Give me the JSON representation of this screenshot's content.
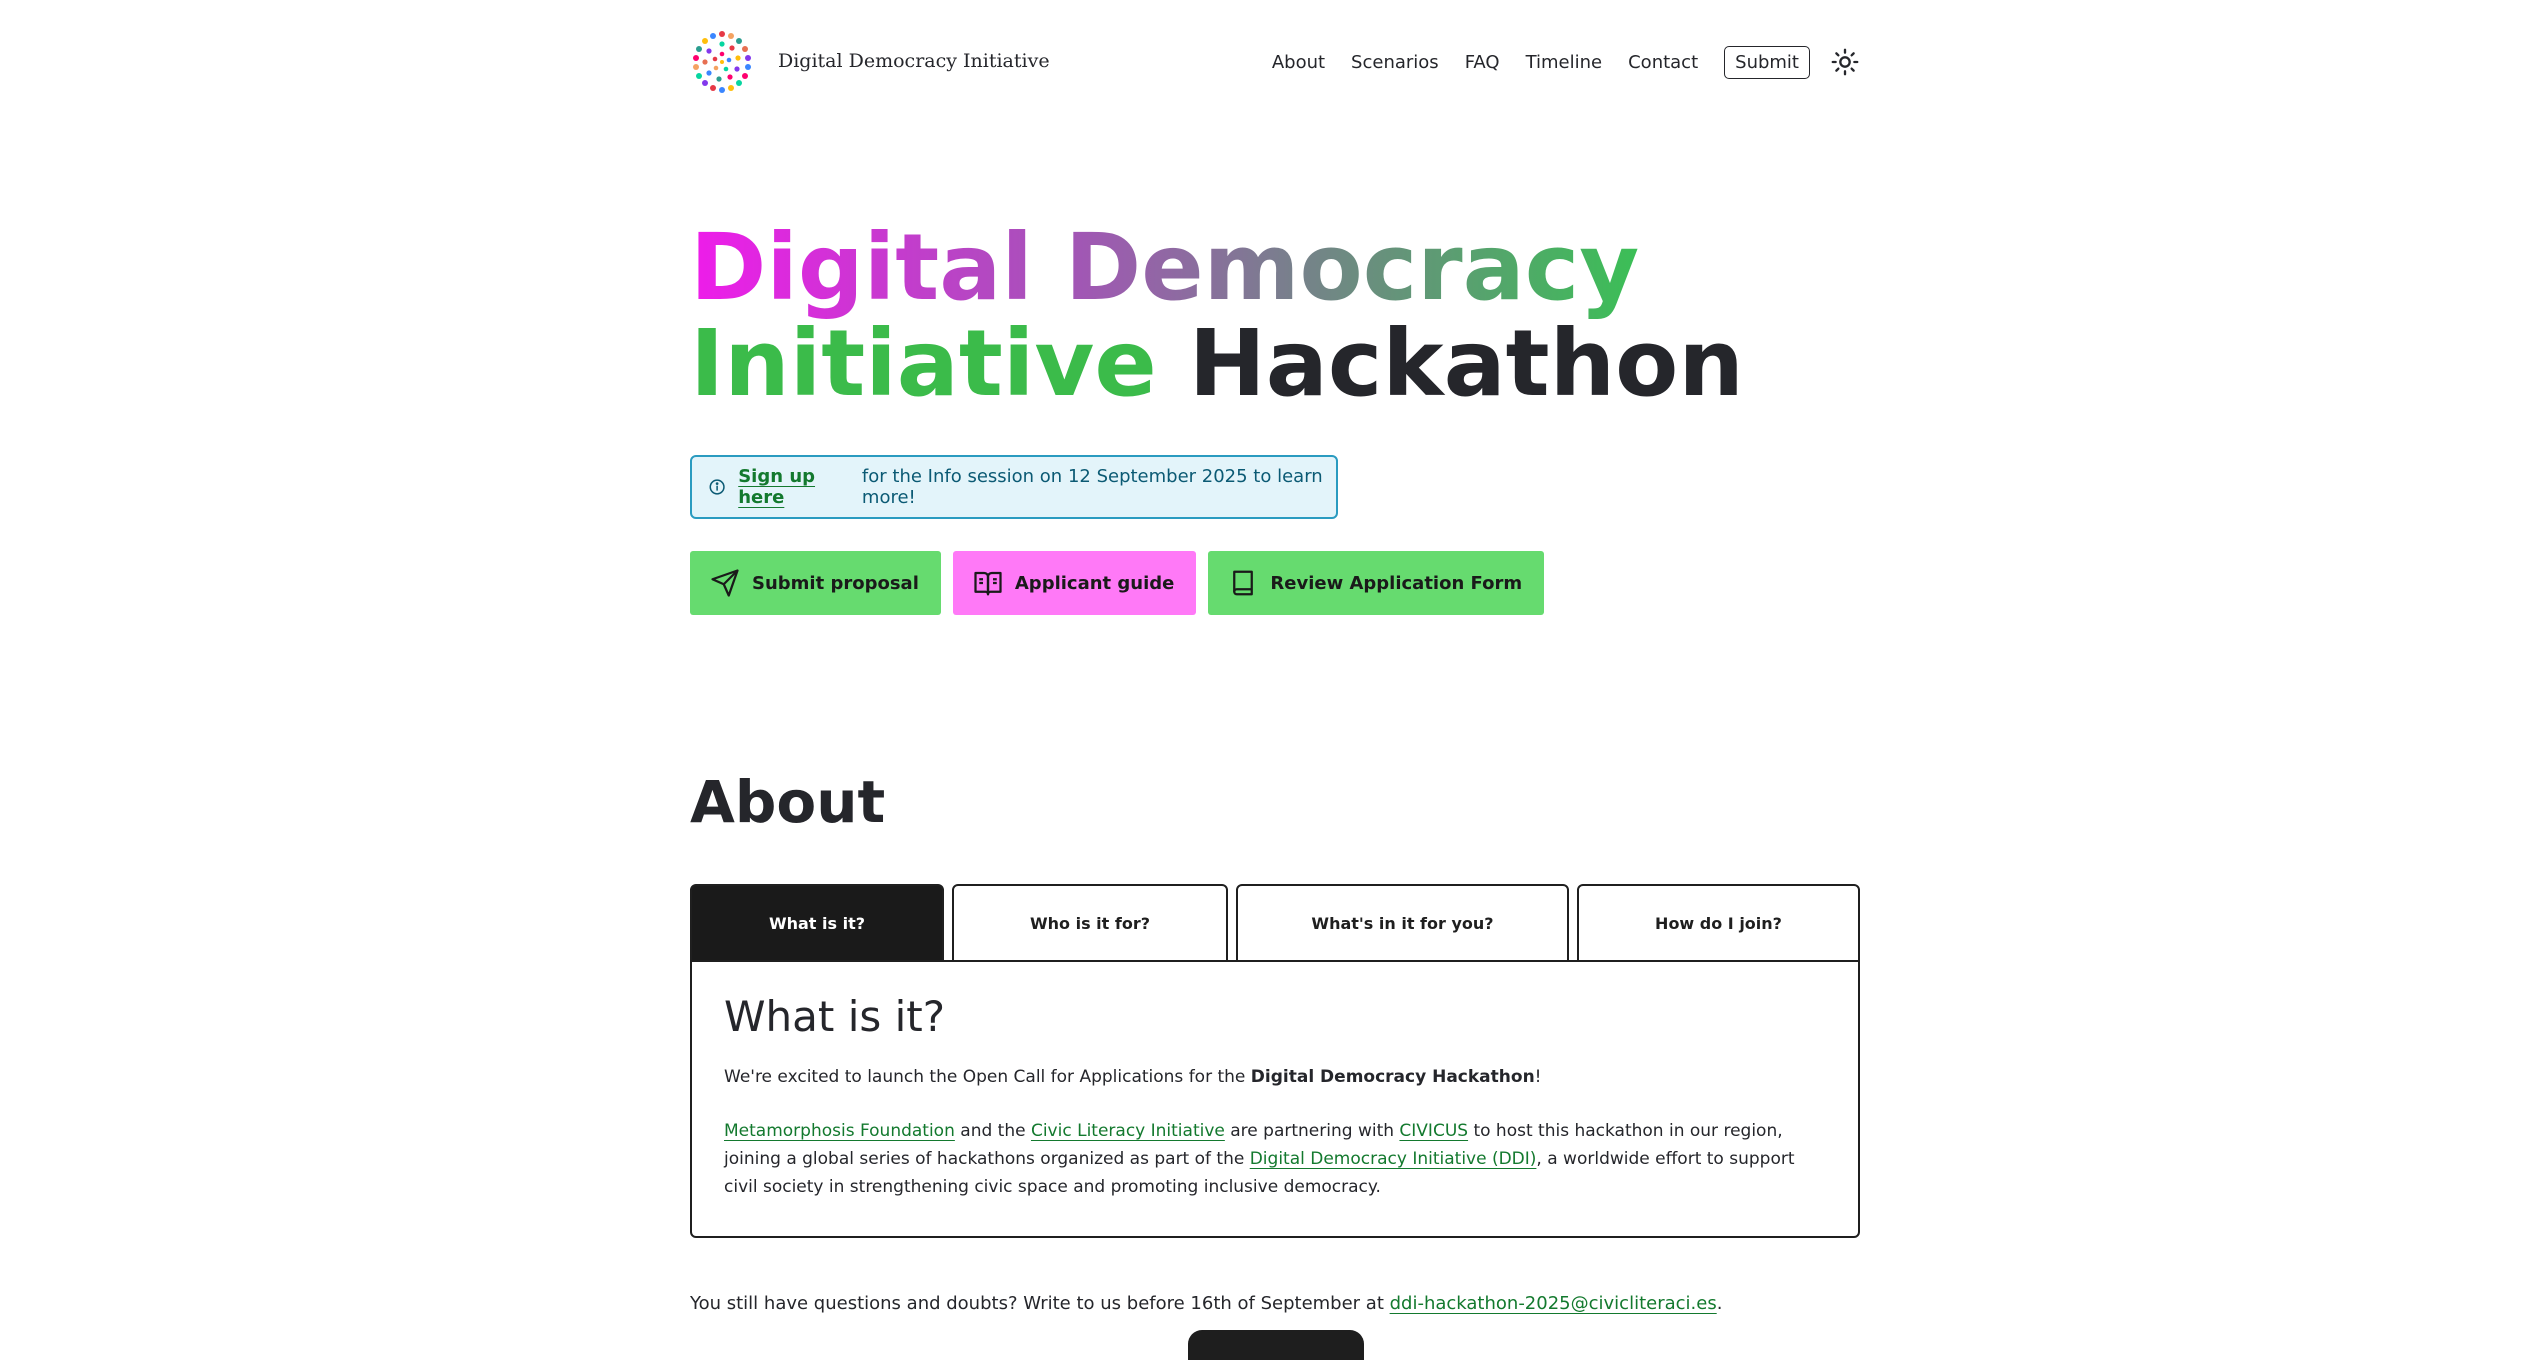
{
  "header": {
    "site_title": "Digital Democracy Initiative",
    "nav": [
      "About",
      "Scenarios",
      "FAQ",
      "Timeline",
      "Contact"
    ],
    "submit_label": "Submit",
    "theme_icon": "sun-icon"
  },
  "hero": {
    "title_part1": "Digital Democracy",
    "title_part2": "Initiative",
    "title_part3": "Hackathon",
    "info": {
      "link": "Sign up here",
      "text": "for the Info session on 12 September 2025 to learn more!"
    },
    "buttons": [
      {
        "label": "Submit proposal",
        "icon": "send-icon",
        "color": "#66db6f"
      },
      {
        "label": "Applicant guide",
        "icon": "book-open-icon",
        "color": "#ff79f7"
      },
      {
        "label": "Review Application Form",
        "icon": "book-icon",
        "color": "#66db6f"
      }
    ]
  },
  "about": {
    "heading": "About",
    "tabs": [
      "What is it?",
      "Who is it for?",
      "What's in it for you?",
      "How do I join?"
    ],
    "panel": {
      "title": "What is it?",
      "p1_text": "We're excited to launch the Open Call for Applications for the ",
      "p1_bold": "Digital Democracy Hackathon",
      "p1_end": "!",
      "p2_link1": "Metamorphosis Foundation",
      "p2_and": " and the ",
      "p2_link2": "Civic Literacy Initiative",
      "p2_mid": " are partnering with ",
      "p2_link3": "CIVICUS",
      "p2_mid2": " to host this hackathon in our region, joining a global series of hackathons organized as part of the ",
      "p2_link4": "Digital Democracy Initiative (DDI)",
      "p2_end": ", a worldwide effort to support civil society in strengthening civic space and promoting inclusive democracy."
    }
  },
  "footer": {
    "text": "You still have questions and doubts? Write to us before 16th of September at ",
    "email": "ddi-hackathon-2025@civicliteraci.es",
    "end": "."
  }
}
